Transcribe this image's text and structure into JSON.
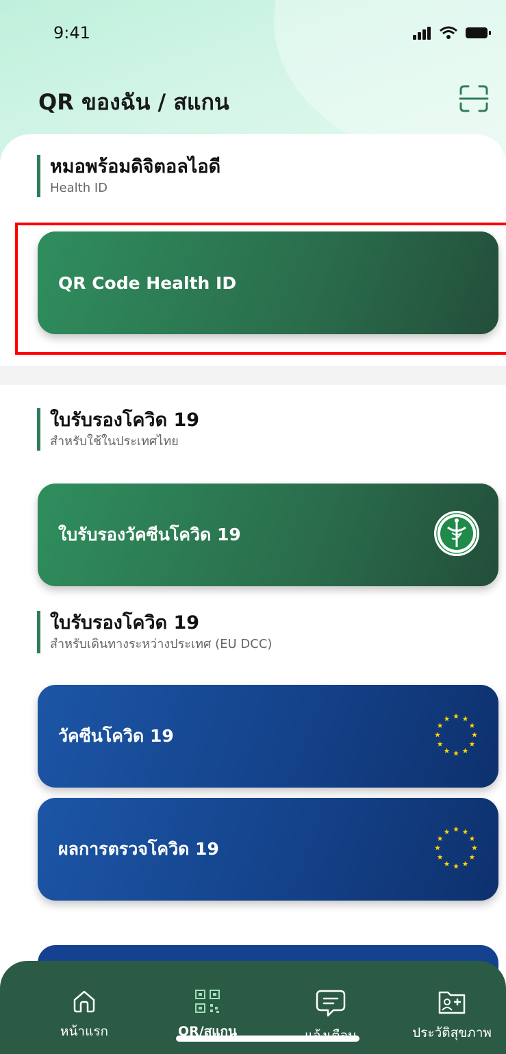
{
  "status_bar": {
    "time": "9:41"
  },
  "header": {
    "title": "QR ของฉัน / สแกน"
  },
  "health_id_section": {
    "title": "หมอพร้อมดิจิตอลไอดี",
    "subtitle": "Health ID",
    "card_label": "QR Code Health ID"
  },
  "thai_cert_section": {
    "title": "ใบรับรองโควิด 19",
    "subtitle": "สำหรับใช้ในประเทศไทย",
    "card_label": "ใบรับรองวัคซีนโควิด 19"
  },
  "eu_cert_section": {
    "title": "ใบรับรองโควิด 19",
    "subtitle": "สำหรับเดินทางระหว่างประเทศ (EU DCC)",
    "cards": [
      {
        "label": "วัคซีนโควิด 19"
      },
      {
        "label": "ผลการตรวจโควิด 19"
      }
    ]
  },
  "tab_bar": {
    "tabs": [
      {
        "label": "หน้าแรก",
        "icon": "home-icon",
        "active": false
      },
      {
        "label": "QR/สแกน",
        "icon": "qr-code-icon",
        "active": true
      },
      {
        "label": "แจ้งเตือน",
        "icon": "chat-bubble-icon",
        "active": false
      },
      {
        "label": "ประวัติสุขภาพ",
        "icon": "health-record-icon",
        "active": false
      }
    ]
  },
  "colors": {
    "accent_green": "#2e7d57",
    "card_green": "#2a6c4c",
    "card_blue": "#14428a",
    "tab_bar": "#2b5a45",
    "highlight": "#ff0000"
  }
}
